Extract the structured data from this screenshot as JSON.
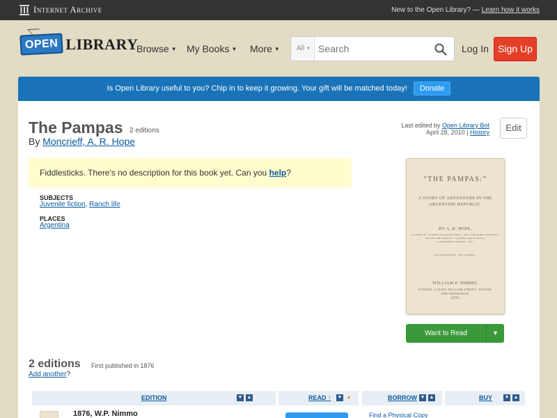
{
  "ia_bar": {
    "logo_text": "Internet Archive",
    "new_text": "New to the Open Library? —",
    "learn_link": "Learn how it works"
  },
  "header": {
    "logo_sign": "OPEN",
    "logo_word": "LIBRARY",
    "nav": [
      {
        "label": "Browse"
      },
      {
        "label": "My Books"
      },
      {
        "label": "More"
      }
    ],
    "search": {
      "scope": "All",
      "placeholder": "Search"
    },
    "login": "Log In",
    "signup": "Sign Up"
  },
  "banner": {
    "text": "Is Open Library useful to you? Chip in to keep it growing. Your gift will be matched today!",
    "donate": "Donate"
  },
  "book": {
    "title": "The Pampas",
    "edition_count": "2 editions",
    "by": "By",
    "author": "Moncrieff, A. R. Hope",
    "last_edited_prefix": "Last edited by",
    "last_edited_by": "Open Library Bot",
    "last_edited_date": "April 28, 2010",
    "history": "History",
    "edit": "Edit",
    "no_desc_text": "Fiddlesticks. There's no description for this book yet. Can you",
    "no_desc_link": "help",
    "no_desc_end": "?",
    "subjects_label": "SUBJECTS",
    "subjects": [
      "Juvenile fiction",
      "Ranch life"
    ],
    "places_label": "PLACES",
    "places": [
      "Argentina"
    ]
  },
  "cover": {
    "title": "“THE PAMPAS:”",
    "subtitle1": "A STORY OF ADVENTURE IN THE",
    "subtitle2": "ARGENTINE REPUBLIC.",
    "author": "BY A. R. HOPE,",
    "author_note1": "AUTHOR OF \"STORIES OF ADVENTURE,\" \"MY SCHOOLBOY FRIENDS,\"",
    "author_note2": "\"ROUND THE WORLD,\" \"STORIES ABOUT BOYS,\"",
    "author_note3": "\"SCHOOLBOY FRIENDS,\" ETC.",
    "illustrated": "ILLUSTRATED BY \"THE CORNER.\"",
    "publisher": "WILLIAM P. NIMMO,",
    "address1": "LONDON: 14 KING WILLIAM STREET, STRAND;",
    "address2": "AND EDINBURGH.",
    "year": "1876."
  },
  "want_to_read": "Want to Read",
  "editions": {
    "title": "2 editions",
    "first_published": "First published in 1876",
    "add_link": "Add another",
    "add_end": "?",
    "columns": {
      "edition": "EDITION",
      "read": "READ ↑",
      "borrow": "BORROW",
      "buy": "BUY"
    },
    "rows": [
      {
        "edition": "1876, W.P. Nimmo",
        "borrow": "Find a Physical Copy"
      }
    ]
  }
}
